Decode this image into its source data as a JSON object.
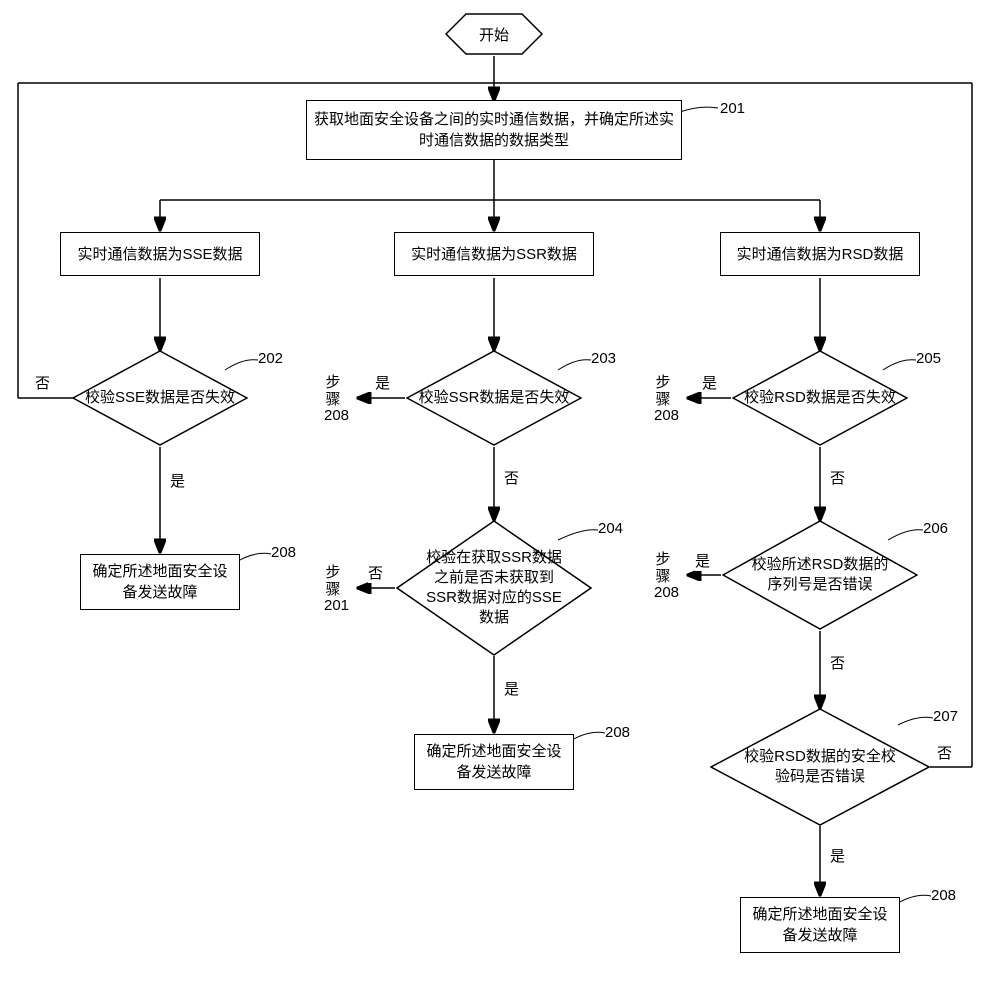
{
  "start": "开始",
  "n201": "获取地面安全设备之间的实时通信数据，并确定所述实时通信数据的数据类型",
  "branch_sse": "实时通信数据为SSE数据",
  "branch_ssr": "实时通信数据为SSR数据",
  "branch_rsd": "实时通信数据为RSD数据",
  "n202": "校验SSE数据是否失效",
  "n203": "校验SSR数据是否失效",
  "n204": "校验在获取SSR数据之前是否未获取到SSR数据对应的SSE数据",
  "n205": "校验RSD数据是否失效",
  "n206": "校验所述RSD数据的序列号是否错误",
  "n207": "校验RSD数据的安全校验码是否错误",
  "n208": "确定所述地面安全设备发送故障",
  "yes": "是",
  "no": "否",
  "step208": "步骤208",
  "step201": "步骤201",
  "ref": {
    "r201": "201",
    "r202": "202",
    "r203": "203",
    "r204": "204",
    "r205": "205",
    "r206": "206",
    "r207": "207",
    "r208": "208"
  },
  "chart_data": {
    "type": "flowchart",
    "nodes": [
      {
        "id": "start",
        "shape": "hexagon",
        "label": "开始"
      },
      {
        "id": "201",
        "shape": "rect",
        "label": "获取地面安全设备之间的实时通信数据，并确定所述实时通信数据的数据类型"
      },
      {
        "id": "b_sse",
        "shape": "rect",
        "label": "实时通信数据为SSE数据"
      },
      {
        "id": "b_ssr",
        "shape": "rect",
        "label": "实时通信数据为SSR数据"
      },
      {
        "id": "b_rsd",
        "shape": "rect",
        "label": "实时通信数据为RSD数据"
      },
      {
        "id": "202",
        "shape": "diamond",
        "label": "校验SSE数据是否失效"
      },
      {
        "id": "203",
        "shape": "diamond",
        "label": "校验SSR数据是否失效"
      },
      {
        "id": "204",
        "shape": "diamond",
        "label": "校验在获取SSR数据之前是否未获取到SSR数据对应的SSE数据"
      },
      {
        "id": "205",
        "shape": "diamond",
        "label": "校验RSD数据是否失效"
      },
      {
        "id": "206",
        "shape": "diamond",
        "label": "校验所述RSD数据的序列号是否错误"
      },
      {
        "id": "207",
        "shape": "diamond",
        "label": "校验RSD数据的安全校验码是否错误"
      },
      {
        "id": "208a",
        "shape": "rect",
        "label": "确定所述地面安全设备发送故障"
      },
      {
        "id": "208b",
        "shape": "rect",
        "label": "确定所述地面安全设备发送故障"
      },
      {
        "id": "208c",
        "shape": "rect",
        "label": "确定所述地面安全设备发送故障"
      }
    ],
    "edges": [
      {
        "from": "start",
        "to": "201"
      },
      {
        "from": "201",
        "to": "b_sse"
      },
      {
        "from": "201",
        "to": "b_ssr"
      },
      {
        "from": "201",
        "to": "b_rsd"
      },
      {
        "from": "b_sse",
        "to": "202"
      },
      {
        "from": "202",
        "to": "208a",
        "label": "是"
      },
      {
        "from": "202",
        "to": "201",
        "label": "否",
        "loop": true
      },
      {
        "from": "b_ssr",
        "to": "203"
      },
      {
        "from": "203",
        "to": "step208",
        "label": "是"
      },
      {
        "from": "203",
        "to": "204",
        "label": "否"
      },
      {
        "from": "204",
        "to": "208b",
        "label": "是"
      },
      {
        "from": "204",
        "to": "step201",
        "label": "否"
      },
      {
        "from": "b_rsd",
        "to": "205"
      },
      {
        "from": "205",
        "to": "step208",
        "label": "是"
      },
      {
        "from": "205",
        "to": "206",
        "label": "否"
      },
      {
        "from": "206",
        "to": "step208",
        "label": "是"
      },
      {
        "from": "206",
        "to": "207",
        "label": "否"
      },
      {
        "from": "207",
        "to": "208c",
        "label": "是"
      },
      {
        "from": "207",
        "to": "201",
        "label": "否",
        "loop": true
      }
    ]
  }
}
